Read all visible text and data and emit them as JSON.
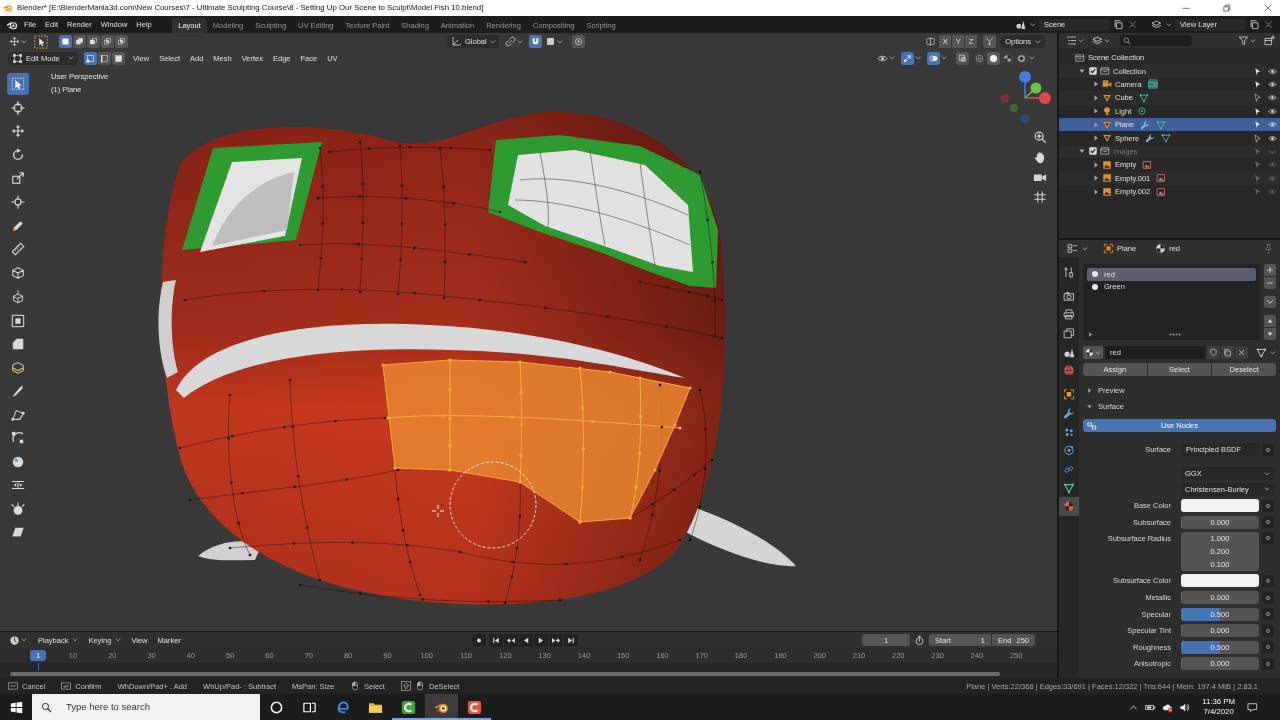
{
  "window": {
    "title": "Blender* [E:\\BlenderMania3d.com\\New Courses\\7 - Ultimate Sculpting Course\\8 - Setting Up Our Scene to Sculpt\\Model Fish 10.blend]"
  },
  "menu": [
    "File",
    "Edit",
    "Render",
    "Window",
    "Help"
  ],
  "workspaces": [
    {
      "label": "Layout",
      "selected": true
    },
    {
      "label": "Modeling",
      "selected": false
    },
    {
      "label": "Sculpting",
      "selected": false
    },
    {
      "label": "UV Editing",
      "selected": false
    },
    {
      "label": "Texture Paint",
      "selected": false
    },
    {
      "label": "Shading",
      "selected": false
    },
    {
      "label": "Animation",
      "selected": false
    },
    {
      "label": "Rendering",
      "selected": false
    },
    {
      "label": "Compositing",
      "selected": false
    },
    {
      "label": "Scripting",
      "selected": false
    }
  ],
  "scene_selector": {
    "scene": "Scene",
    "view_layer": "View Layer"
  },
  "viewport": {
    "header": {
      "select_sets": [
        {
          "kind": "set",
          "selected": true
        },
        {
          "kind": "extend",
          "selected": false
        },
        {
          "kind": "subtract",
          "selected": false
        },
        {
          "kind": "invert",
          "selected": false
        },
        {
          "kind": "intersect",
          "selected": false
        }
      ],
      "orientation": "Global",
      "snap": true,
      "proportional": false,
      "mirror_axes": [
        {
          "label": "X",
          "on": false
        },
        {
          "label": "Y",
          "on": false
        },
        {
          "label": "Z",
          "on": false
        }
      ],
      "options": "Options",
      "mode": "Edit Mode",
      "select_modes": [
        {
          "kind": "vertex",
          "selected": true
        },
        {
          "kind": "edge",
          "selected": false
        },
        {
          "kind": "face",
          "selected": false
        }
      ],
      "menus": [
        "View",
        "Select",
        "Add",
        "Mesh",
        "Vertex",
        "Edge",
        "Face",
        "UV"
      ],
      "gizmos": true,
      "overlays": true,
      "xray": false,
      "shading": [
        {
          "kind": "wireframe",
          "selected": false
        },
        {
          "kind": "solid",
          "selected": true
        },
        {
          "kind": "material",
          "selected": false
        },
        {
          "kind": "rendered",
          "selected": false
        }
      ]
    },
    "overlay_text": [
      "User Perspective",
      "(1) Plane"
    ],
    "tools": [
      [
        {
          "kind": "select",
          "selected": true
        },
        {
          "kind": "cursor",
          "selected": false
        },
        {
          "kind": "move",
          "selected": false
        },
        {
          "kind": "rotate",
          "selected": false
        },
        {
          "kind": "scale",
          "selected": false
        },
        {
          "kind": "transform",
          "selected": false
        }
      ],
      [
        {
          "kind": "annotate",
          "selected": false
        },
        {
          "kind": "measure",
          "selected": false
        }
      ],
      [
        {
          "kind": "add-cube",
          "selected": false
        }
      ],
      [
        {
          "kind": "extrude",
          "selected": false
        },
        {
          "kind": "inset",
          "selected": false
        },
        {
          "kind": "bevel",
          "selected": false
        },
        {
          "kind": "loop-cut",
          "selected": false
        },
        {
          "kind": "knife",
          "selected": false
        },
        {
          "kind": "poly-build",
          "selected": false
        },
        {
          "kind": "spin",
          "selected": false
        },
        {
          "kind": "smooth",
          "selected": false
        },
        {
          "kind": "edge-slide",
          "selected": false
        },
        {
          "kind": "shrink",
          "selected": false
        },
        {
          "kind": "shear",
          "selected": false
        }
      ]
    ]
  },
  "outliner": {
    "root": "Scene Collection",
    "items": [
      {
        "name": "Collection",
        "kind": "collection",
        "checked": true,
        "expanded": true,
        "selectable": true,
        "visible": true,
        "selected": false,
        "children": [
          {
            "name": "Camera",
            "kind": "camera",
            "expanded": false,
            "modifiers": false,
            "data_active": true,
            "selectable": true,
            "visible": true,
            "selected": false
          },
          {
            "name": "Cube",
            "kind": "mesh",
            "expanded": false,
            "modifiers": false,
            "data_active": false,
            "selectable": false,
            "visible": true,
            "selected": false
          },
          {
            "name": "Light",
            "kind": "light",
            "expanded": false,
            "modifiers": false,
            "data_active": false,
            "selectable": true,
            "visible": true,
            "selected": false
          },
          {
            "name": "Plane",
            "kind": "mesh",
            "expanded": false,
            "modifiers": true,
            "data_active": false,
            "selectable": true,
            "visible": true,
            "selected": true
          },
          {
            "name": "Sphere",
            "kind": "mesh",
            "expanded": false,
            "modifiers": true,
            "data_active": false,
            "selectable": false,
            "visible": true,
            "selected": false
          }
        ]
      },
      {
        "name": "Images",
        "kind": "collection",
        "checked": true,
        "expanded": true,
        "selectable": true,
        "visible": false,
        "selected": false,
        "children": [
          {
            "name": "Empty",
            "kind": "image",
            "expanded": false,
            "modifiers": false,
            "data_active": false,
            "selectable": true,
            "visible": true,
            "selected": false
          },
          {
            "name": "Empty.001",
            "kind": "image",
            "expanded": false,
            "modifiers": false,
            "data_active": false,
            "selectable": true,
            "visible": true,
            "selected": false
          },
          {
            "name": "Empty.002",
            "kind": "image",
            "expanded": false,
            "modifiers": false,
            "data_active": false,
            "selectable": true,
            "visible": true,
            "selected": false
          }
        ]
      }
    ]
  },
  "properties": {
    "object": "Plane",
    "material": "red",
    "tabs": [
      [
        {
          "kind": "tool",
          "selected": false
        }
      ],
      [
        {
          "kind": "render",
          "selected": false
        },
        {
          "kind": "output",
          "selected": false
        },
        {
          "kind": "view-layer",
          "selected": false
        },
        {
          "kind": "scene",
          "selected": false
        },
        {
          "kind": "world",
          "selected": false
        }
      ],
      [
        {
          "kind": "object",
          "selected": false
        },
        {
          "kind": "modifiers",
          "selected": false
        },
        {
          "kind": "particles",
          "selected": false
        },
        {
          "kind": "physics",
          "selected": false
        },
        {
          "kind": "constraints",
          "selected": false
        },
        {
          "kind": "data",
          "selected": false
        },
        {
          "kind": "material",
          "selected": true
        }
      ]
    ],
    "slots": [
      {
        "name": "red",
        "selected": true
      },
      {
        "name": "Green",
        "selected": false
      }
    ],
    "material_field": "red",
    "slot_actions": [
      "Assign",
      "Select",
      "Deselect"
    ],
    "panels": [
      {
        "title": "Preview",
        "expanded": false
      },
      {
        "title": "Surface",
        "expanded": true,
        "use_nodes": {
          "label": "Use Nodes",
          "on": true
        },
        "fields": [
          {
            "kind": "shader",
            "label": "Surface",
            "value": "Principled BSDF"
          },
          {
            "kind": "dropdown",
            "value": "GGX"
          },
          {
            "kind": "dropdown",
            "value": "Christensen-Burley"
          },
          {
            "kind": "color",
            "label": "Base Color",
            "color": "#f2f2f2"
          },
          {
            "kind": "slider",
            "label": "Subsurface",
            "value": "0.000",
            "level": 0
          },
          {
            "kind": "vector",
            "label": "Subsurface Radius",
            "values": [
              "1.000",
              "0.200",
              "0.100"
            ]
          },
          {
            "kind": "color",
            "label": "Subsurface Color",
            "color": "#f2f2f2"
          },
          {
            "kind": "slider",
            "label": "Metallic",
            "value": "0.000",
            "level": 0
          },
          {
            "kind": "slider",
            "label": "Specular",
            "value": "0.500",
            "level": 0.5
          },
          {
            "kind": "slider",
            "label": "Specular Tint",
            "value": "0.000",
            "level": 0
          },
          {
            "kind": "slider",
            "label": "Roughness",
            "value": "0.500",
            "level": 0.5
          },
          {
            "kind": "slider",
            "label": "Anisotropic",
            "value": "0.000",
            "level": 0
          }
        ]
      }
    ]
  },
  "timeline": {
    "menus": [
      {
        "label": "Playback",
        "dropdown": true
      },
      {
        "label": "Keying",
        "dropdown": true
      },
      {
        "label": "View",
        "dropdown": false
      },
      {
        "label": "Marker",
        "dropdown": false
      }
    ],
    "current_frame": "1",
    "start": {
      "label": "Start",
      "value": "1"
    },
    "end": {
      "label": "End",
      "value": "250"
    },
    "playhead": "1",
    "ticks": [
      "10",
      "20",
      "30",
      "40",
      "50",
      "60",
      "70",
      "80",
      "90",
      "100",
      "110",
      "120",
      "130",
      "140",
      "150",
      "160",
      "170",
      "180",
      "190",
      "200",
      "210",
      "220",
      "230",
      "240",
      "250"
    ]
  },
  "status_bar": {
    "hints": [
      {
        "kind": "esc",
        "label": "Cancel"
      },
      {
        "kind": "enter",
        "label": "Confirm"
      },
      {
        "kind": "text",
        "label": "WhDown/Pad+ : Add"
      },
      {
        "kind": "text",
        "label": "WhUp/Pad- : Subtract"
      },
      {
        "kind": "text",
        "label": "MsPan: Size"
      },
      {
        "kind": "mouse",
        "label": "Select"
      },
      {
        "kind": "shift-mouse",
        "label": "DeSelect"
      }
    ],
    "stats": "Plane | Verts:22/368 | Edges:33/691 | Faces:12/322 | Tris:644 | Mem: 197.4 MiB | 2.83.1"
  },
  "taskbar": {
    "search_placeholder": "Type here to search",
    "apps": [
      {
        "kind": "browser",
        "open": false,
        "selected": false
      },
      {
        "kind": "files",
        "open": false,
        "selected": false
      },
      {
        "kind": "c-app-green",
        "open": true,
        "selected": false
      },
      {
        "kind": "blender",
        "open": true,
        "selected": true
      },
      {
        "kind": "c-app-red",
        "open": true,
        "selected": false
      }
    ],
    "time": "11:36 PM",
    "date": "7/4/2020"
  }
}
